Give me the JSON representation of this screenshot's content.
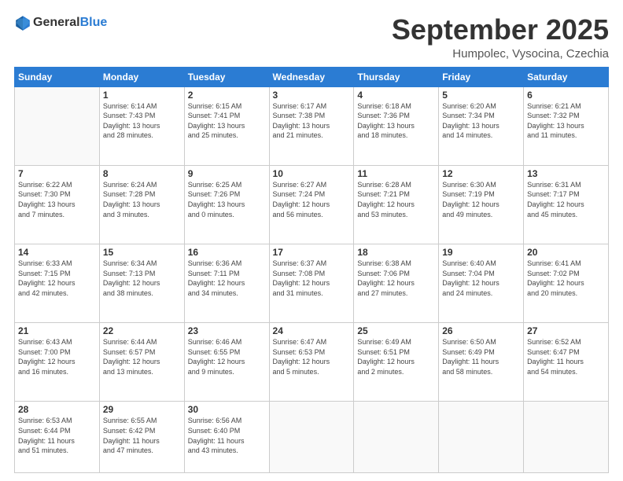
{
  "header": {
    "logo_line1": "General",
    "logo_line2": "Blue",
    "month": "September 2025",
    "location": "Humpolec, Vysocina, Czechia"
  },
  "days_of_week": [
    "Sunday",
    "Monday",
    "Tuesday",
    "Wednesday",
    "Thursday",
    "Friday",
    "Saturday"
  ],
  "weeks": [
    [
      {
        "day": "",
        "info": ""
      },
      {
        "day": "1",
        "info": "Sunrise: 6:14 AM\nSunset: 7:43 PM\nDaylight: 13 hours\nand 28 minutes."
      },
      {
        "day": "2",
        "info": "Sunrise: 6:15 AM\nSunset: 7:41 PM\nDaylight: 13 hours\nand 25 minutes."
      },
      {
        "day": "3",
        "info": "Sunrise: 6:17 AM\nSunset: 7:38 PM\nDaylight: 13 hours\nand 21 minutes."
      },
      {
        "day": "4",
        "info": "Sunrise: 6:18 AM\nSunset: 7:36 PM\nDaylight: 13 hours\nand 18 minutes."
      },
      {
        "day": "5",
        "info": "Sunrise: 6:20 AM\nSunset: 7:34 PM\nDaylight: 13 hours\nand 14 minutes."
      },
      {
        "day": "6",
        "info": "Sunrise: 6:21 AM\nSunset: 7:32 PM\nDaylight: 13 hours\nand 11 minutes."
      }
    ],
    [
      {
        "day": "7",
        "info": "Sunrise: 6:22 AM\nSunset: 7:30 PM\nDaylight: 13 hours\nand 7 minutes."
      },
      {
        "day": "8",
        "info": "Sunrise: 6:24 AM\nSunset: 7:28 PM\nDaylight: 13 hours\nand 3 minutes."
      },
      {
        "day": "9",
        "info": "Sunrise: 6:25 AM\nSunset: 7:26 PM\nDaylight: 13 hours\nand 0 minutes."
      },
      {
        "day": "10",
        "info": "Sunrise: 6:27 AM\nSunset: 7:24 PM\nDaylight: 12 hours\nand 56 minutes."
      },
      {
        "day": "11",
        "info": "Sunrise: 6:28 AM\nSunset: 7:21 PM\nDaylight: 12 hours\nand 53 minutes."
      },
      {
        "day": "12",
        "info": "Sunrise: 6:30 AM\nSunset: 7:19 PM\nDaylight: 12 hours\nand 49 minutes."
      },
      {
        "day": "13",
        "info": "Sunrise: 6:31 AM\nSunset: 7:17 PM\nDaylight: 12 hours\nand 45 minutes."
      }
    ],
    [
      {
        "day": "14",
        "info": "Sunrise: 6:33 AM\nSunset: 7:15 PM\nDaylight: 12 hours\nand 42 minutes."
      },
      {
        "day": "15",
        "info": "Sunrise: 6:34 AM\nSunset: 7:13 PM\nDaylight: 12 hours\nand 38 minutes."
      },
      {
        "day": "16",
        "info": "Sunrise: 6:36 AM\nSunset: 7:11 PM\nDaylight: 12 hours\nand 34 minutes."
      },
      {
        "day": "17",
        "info": "Sunrise: 6:37 AM\nSunset: 7:08 PM\nDaylight: 12 hours\nand 31 minutes."
      },
      {
        "day": "18",
        "info": "Sunrise: 6:38 AM\nSunset: 7:06 PM\nDaylight: 12 hours\nand 27 minutes."
      },
      {
        "day": "19",
        "info": "Sunrise: 6:40 AM\nSunset: 7:04 PM\nDaylight: 12 hours\nand 24 minutes."
      },
      {
        "day": "20",
        "info": "Sunrise: 6:41 AM\nSunset: 7:02 PM\nDaylight: 12 hours\nand 20 minutes."
      }
    ],
    [
      {
        "day": "21",
        "info": "Sunrise: 6:43 AM\nSunset: 7:00 PM\nDaylight: 12 hours\nand 16 minutes."
      },
      {
        "day": "22",
        "info": "Sunrise: 6:44 AM\nSunset: 6:57 PM\nDaylight: 12 hours\nand 13 minutes."
      },
      {
        "day": "23",
        "info": "Sunrise: 6:46 AM\nSunset: 6:55 PM\nDaylight: 12 hours\nand 9 minutes."
      },
      {
        "day": "24",
        "info": "Sunrise: 6:47 AM\nSunset: 6:53 PM\nDaylight: 12 hours\nand 5 minutes."
      },
      {
        "day": "25",
        "info": "Sunrise: 6:49 AM\nSunset: 6:51 PM\nDaylight: 12 hours\nand 2 minutes."
      },
      {
        "day": "26",
        "info": "Sunrise: 6:50 AM\nSunset: 6:49 PM\nDaylight: 11 hours\nand 58 minutes."
      },
      {
        "day": "27",
        "info": "Sunrise: 6:52 AM\nSunset: 6:47 PM\nDaylight: 11 hours\nand 54 minutes."
      }
    ],
    [
      {
        "day": "28",
        "info": "Sunrise: 6:53 AM\nSunset: 6:44 PM\nDaylight: 11 hours\nand 51 minutes."
      },
      {
        "day": "29",
        "info": "Sunrise: 6:55 AM\nSunset: 6:42 PM\nDaylight: 11 hours\nand 47 minutes."
      },
      {
        "day": "30",
        "info": "Sunrise: 6:56 AM\nSunset: 6:40 PM\nDaylight: 11 hours\nand 43 minutes."
      },
      {
        "day": "",
        "info": ""
      },
      {
        "day": "",
        "info": ""
      },
      {
        "day": "",
        "info": ""
      },
      {
        "day": "",
        "info": ""
      }
    ]
  ]
}
